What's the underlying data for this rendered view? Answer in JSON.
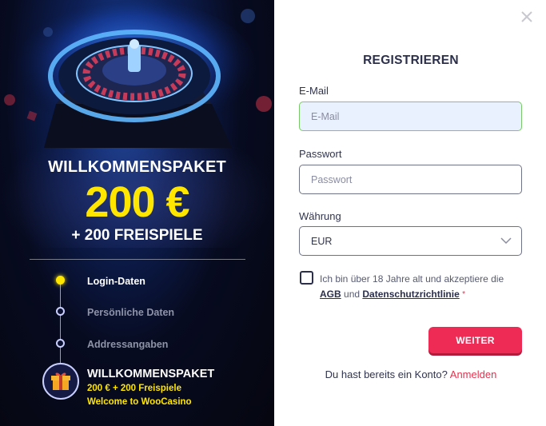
{
  "promo": {
    "title": "WILLKOMMENSPAKET",
    "amount": "200 €",
    "spins": "+ 200 FREISPIELE",
    "steps": [
      {
        "label": "Login-Daten",
        "active": true
      },
      {
        "label": "Persönliche Daten",
        "active": false
      },
      {
        "label": "Addressangaben",
        "active": false
      }
    ],
    "bonus": {
      "title": "WILLKOMMENSPAKET",
      "line1": "200 € + 200 Freispiele",
      "line2": "Welcome to WooCasino"
    }
  },
  "form": {
    "title": "REGISTRIEREN",
    "email": {
      "label": "E-Mail",
      "placeholder": "E-Mail",
      "value": ""
    },
    "password": {
      "label": "Passwort",
      "placeholder": "Passwort",
      "value": ""
    },
    "currency": {
      "label": "Währung",
      "value": "EUR"
    },
    "consent": {
      "prefix": "Ich bin über 18 Jahre alt und akzeptiere die",
      "agb": "AGB",
      "and": "und",
      "privacy": "Datenschutzrichtlinie",
      "required_mark": "*"
    },
    "submit_label": "WEITER",
    "login_prompt": "Du hast bereits ein Konto?",
    "login_link": "Anmelden"
  },
  "colors": {
    "accent": "#ee2b55",
    "highlight": "#ffe600",
    "text": "#2b2f4a"
  }
}
